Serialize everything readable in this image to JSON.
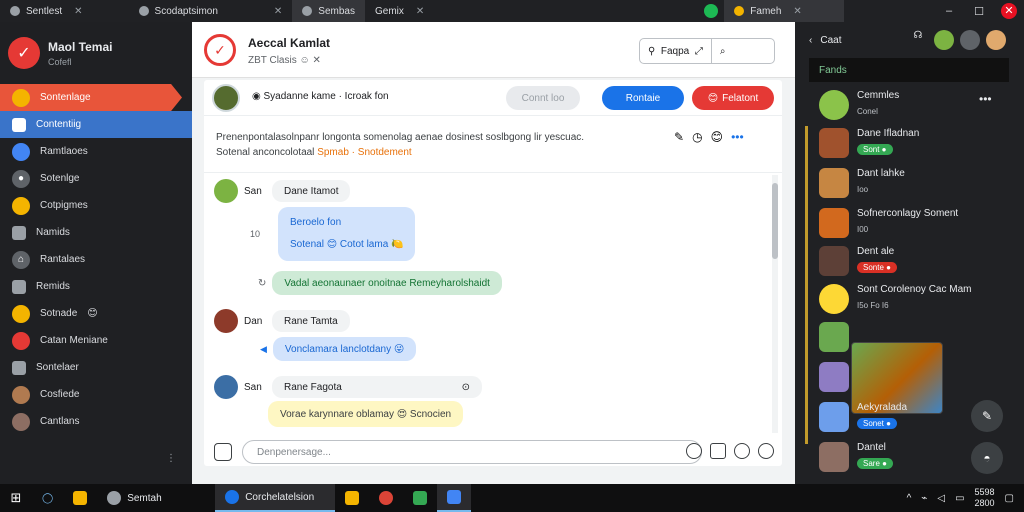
{
  "tabs": [
    {
      "label": "Sentlest",
      "active": false
    },
    {
      "label": "Scodaptsimon",
      "active": false
    },
    {
      "label": "Sembas",
      "active": true
    },
    {
      "label": "Gemix",
      "active": false
    }
  ],
  "browser_right": {
    "tab_label": "Fameh"
  },
  "sidebar": {
    "title": "Maol Temai",
    "subtitle": "Cofefl",
    "items": [
      {
        "label": "Sontenlage",
        "style": "red"
      },
      {
        "label": "Contentiig",
        "style": "blue"
      },
      {
        "label": "Ramtlaoes",
        "style": "normal"
      },
      {
        "label": "Sotenlge",
        "style": "normal"
      },
      {
        "label": "Cotpigmes",
        "style": "normal"
      },
      {
        "label": "Namids",
        "style": "normal"
      },
      {
        "label": "Rantalaes",
        "style": "normal"
      },
      {
        "label": "Remids",
        "style": "normal"
      },
      {
        "label": "Sotnade",
        "style": "normal"
      },
      {
        "label": "Catan Meniane",
        "style": "normal"
      },
      {
        "label": "Sontelaer",
        "style": "normal"
      },
      {
        "label": "Cosfiede",
        "style": "normal"
      },
      {
        "label": "Cantlans",
        "style": "normal"
      }
    ]
  },
  "chat_header": {
    "title": "Aeccal Kamlat",
    "subtitle": "ZBT Clasis",
    "search_label": "Faqpa"
  },
  "sub_header": {
    "text": "Syadanne kame · Icroak fon",
    "btn_ghost": "Connt loo",
    "btn_blue": "Rontaie",
    "btn_red": "Felatont"
  },
  "notice": {
    "line1": "Prenenpontalasolnpanr longonta somenolag aenae dosinest soslbgong lir yescuac.",
    "line2_plain": "Sotenal anconcolotaal",
    "line2_orange": "Spmab · Snotdement"
  },
  "messages": [
    {
      "name": "San",
      "text": "Dane Itamot",
      "style": "grey"
    },
    {
      "line1": "Beroelo fon",
      "line2": "Sotenal 😊 Cotot lama 🍋",
      "style": "blue",
      "time": "10"
    },
    {
      "text": "Vadal aeonaunaer onoitnae Remeyharolshaidt",
      "style": "green"
    },
    {
      "name": "Dan",
      "text": "Rane Tamta",
      "style": "grey"
    },
    {
      "text": "Vonclamara lanclotdany 😜",
      "style": "blue"
    },
    {
      "name": "San",
      "text": "Rane Fagota",
      "style": "grey"
    },
    {
      "text": "Vorae karynnare oblamay 😍 Scnocien",
      "style": "yellow"
    }
  ],
  "composer": {
    "placeholder": "Denpenersage..."
  },
  "right_panel": {
    "back_label": "Caat",
    "tab_label": "Fands",
    "items": [
      {
        "name": "Cemmles",
        "badge": "Conel",
        "badge_style": "plain"
      },
      {
        "name": "Dane Ifladnan",
        "badge": "Sont ●",
        "badge_style": "green"
      },
      {
        "name": "Dant lahke",
        "badge": "Ioo",
        "badge_style": "plain"
      },
      {
        "name": "Sofnerconlagy Soment",
        "badge": "I00",
        "badge_style": "plain"
      },
      {
        "name": "Dent ale",
        "badge": "Sonte ●",
        "badge_style": "red"
      },
      {
        "name": "Sont Corolenoy Cac Mam",
        "badge": "I5o Fo I6",
        "badge_style": "plain"
      },
      {
        "name": "Aekyralada",
        "badge": "Sonet ●",
        "badge_style": "blue"
      },
      {
        "name": "Dantel",
        "badge": "Sare ●",
        "badge_style": "green"
      }
    ]
  },
  "taskbar": {
    "items": [
      {
        "label": "Semtah",
        "active": false
      },
      {
        "label": "Corchelatelsion",
        "active": true
      }
    ],
    "clock_time": "5598",
    "clock_date": "2800"
  }
}
